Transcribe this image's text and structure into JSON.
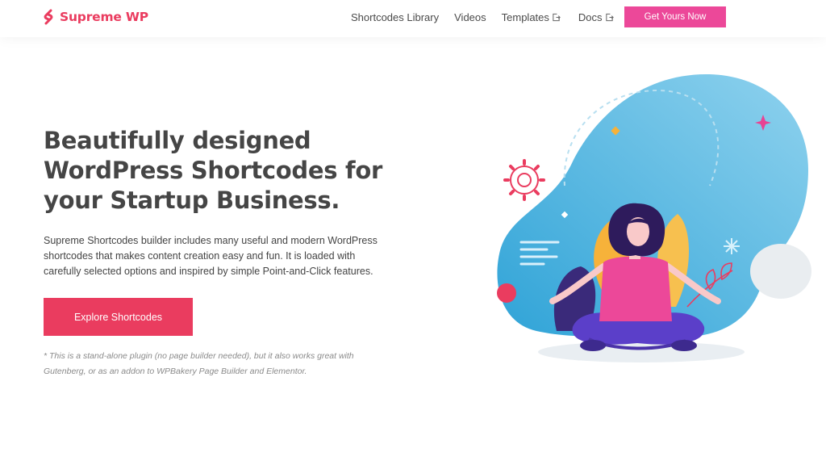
{
  "header": {
    "logo_text": "Supreme WP",
    "nav": [
      {
        "label": "Shortcodes Library",
        "external": false
      },
      {
        "label": "Videos",
        "external": false
      },
      {
        "label": "Templates",
        "external": true
      },
      {
        "label": "Docs",
        "external": true
      }
    ],
    "cta_label": "Get Yours Now"
  },
  "hero": {
    "title_lines": [
      "Beautifully designed",
      "WordPress Shortcodes for",
      "your Startup Business."
    ],
    "description": "Supreme Shortcodes builder includes many useful and modern WordPress shortcodes that makes content creation easy and fun. It is loaded with carefully selected options and inspired by simple Point-and-Click features.",
    "button_label": "Explore Shortcodes",
    "note": "* This is a stand-alone plugin (no page builder needed), but it also works great with Gutenberg, or as an addon to WPBakery Page Builder and Elementor."
  },
  "colors": {
    "brand": "#ea3c5f",
    "cta": "#ec4899",
    "blob": "#4fb3de",
    "shirt": "#ec4899",
    "pants": "#5b3fc9",
    "leaf": "#f6b23a"
  },
  "icons": {
    "logo": "supreme-s-logo-icon",
    "external": "external-link-icon"
  }
}
